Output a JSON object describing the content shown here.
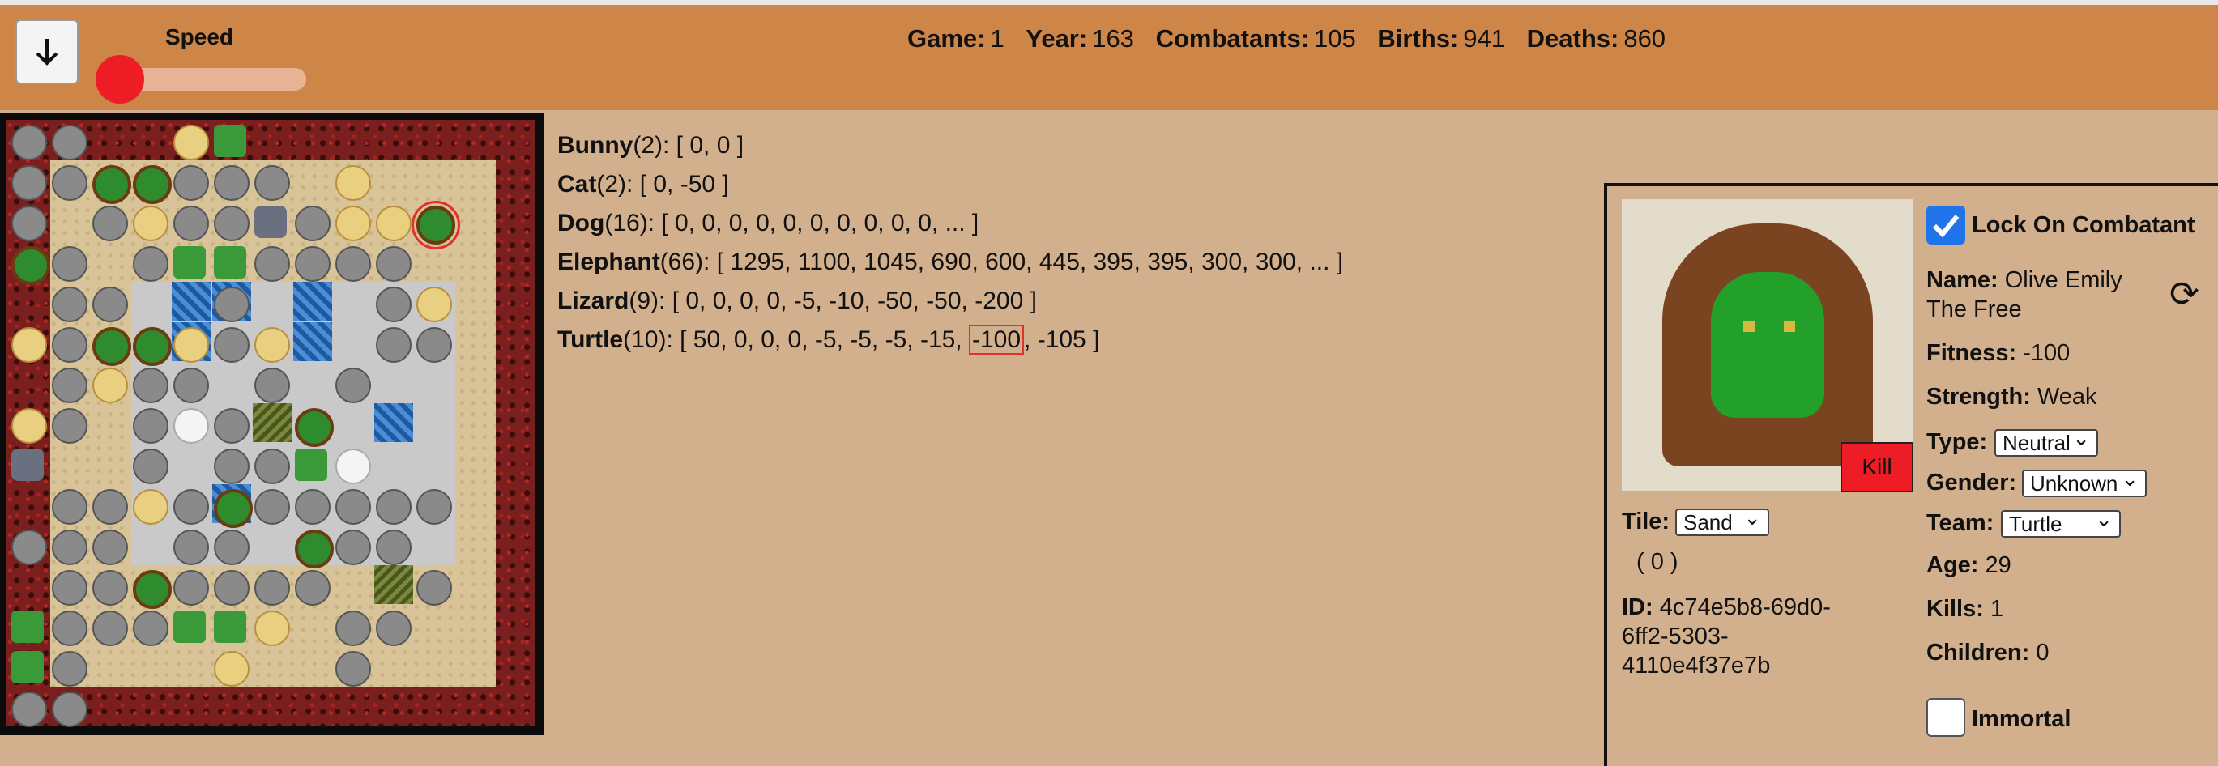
{
  "header": {
    "speed_label": "Speed",
    "speed_value": 0.0,
    "stats": [
      {
        "label": "Game:",
        "value": "1"
      },
      {
        "label": "Year:",
        "value": "163"
      },
      {
        "label": "Combatants:",
        "value": "105"
      },
      {
        "label": "Births:",
        "value": "941"
      },
      {
        "label": "Deaths:",
        "value": "860"
      }
    ],
    "down_icon": "arrow-down-icon"
  },
  "species": [
    {
      "name": "Bunny",
      "count": "(2):",
      "values": "[ 0, 0 ]"
    },
    {
      "name": "Cat",
      "count": "(2):",
      "values": "[ 0, -50 ]"
    },
    {
      "name": "Dog",
      "count": "(16):",
      "values": "[ 0, 0, 0, 0, 0, 0, 0, 0, 0, 0, ... ]"
    },
    {
      "name": "Elephant",
      "count": "(66):",
      "values": "[ 1295, 1100, 1045, 690, 600, 445, 395, 395, 300, 300, ... ]"
    },
    {
      "name": "Lizard",
      "count": "(9):",
      "values": "[ 0, 0, 0, 0, -5, -10, -50, -50, -200 ]"
    },
    {
      "name": "Turtle",
      "count": "(10):",
      "values_before": "[ 50, 0, 0, 0, -5, -5, -5, -15, ",
      "values_highlight": "-100",
      "values_after": ", -105 ]"
    }
  ],
  "combatant": {
    "lock_label": "Lock On Combatant",
    "lock_checked": true,
    "name_label": "Name:",
    "name_line1": "Olive Emily",
    "name_line2": "The Free",
    "fitness_label": "Fitness:",
    "fitness": "-100",
    "strength_label": "Strength:",
    "strength": "Weak",
    "type_label": "Type:",
    "type": "Neutral",
    "gender_label": "Gender:",
    "gender": "Unknown",
    "team_label": "Team:",
    "team": "Turtle",
    "age_label": "Age:",
    "age": "29",
    "kills_label": "Kills:",
    "kills": "1",
    "children_label": "Children:",
    "children": "0",
    "immortal_label": "Immortal",
    "immortal_checked": false,
    "kill_label": "Kill",
    "tile_label": "Tile:",
    "tile": "Sand",
    "tile_value": "( 0 )",
    "id_label": "ID:",
    "id_line1": "4c74e5b8-69d0-",
    "id_line2": "6ff2-5303-",
    "id_line3": "4110e4f37e7b",
    "refresh_icon": "refresh-icon"
  }
}
